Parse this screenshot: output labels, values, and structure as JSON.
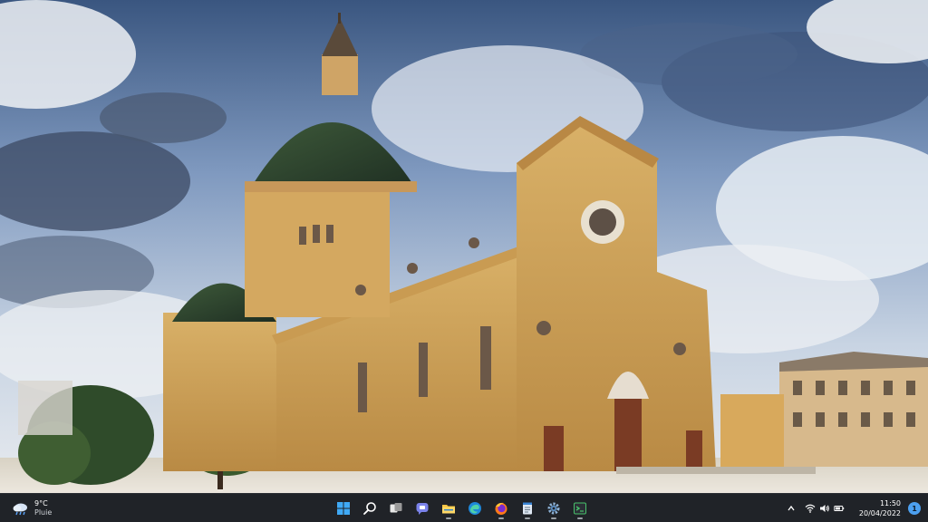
{
  "wallpaper": {
    "icon": "cathedral-painting"
  },
  "taskbar": {
    "weather": {
      "temperature": "9°C",
      "condition": "Pluie",
      "icon": "rain-cloud-icon"
    },
    "apps": [
      {
        "name": "start",
        "icon": "windows-logo-icon",
        "running": false
      },
      {
        "name": "search",
        "icon": "search-icon",
        "running": false
      },
      {
        "name": "task-view",
        "icon": "task-view-icon",
        "running": false
      },
      {
        "name": "chat",
        "icon": "teams-chat-icon",
        "running": false
      },
      {
        "name": "file-explorer",
        "icon": "folder-icon",
        "running": true
      },
      {
        "name": "edge",
        "icon": "edge-icon",
        "running": false
      },
      {
        "name": "firefox",
        "icon": "firefox-icon",
        "running": true
      },
      {
        "name": "notepad",
        "icon": "notepad-icon",
        "running": true
      },
      {
        "name": "settings",
        "icon": "gear-icon",
        "running": true
      },
      {
        "name": "terminal",
        "icon": "terminal-icon",
        "running": true
      }
    ],
    "tray": {
      "time": "11:50",
      "date": "20/04/2022",
      "notifications": "1"
    }
  }
}
